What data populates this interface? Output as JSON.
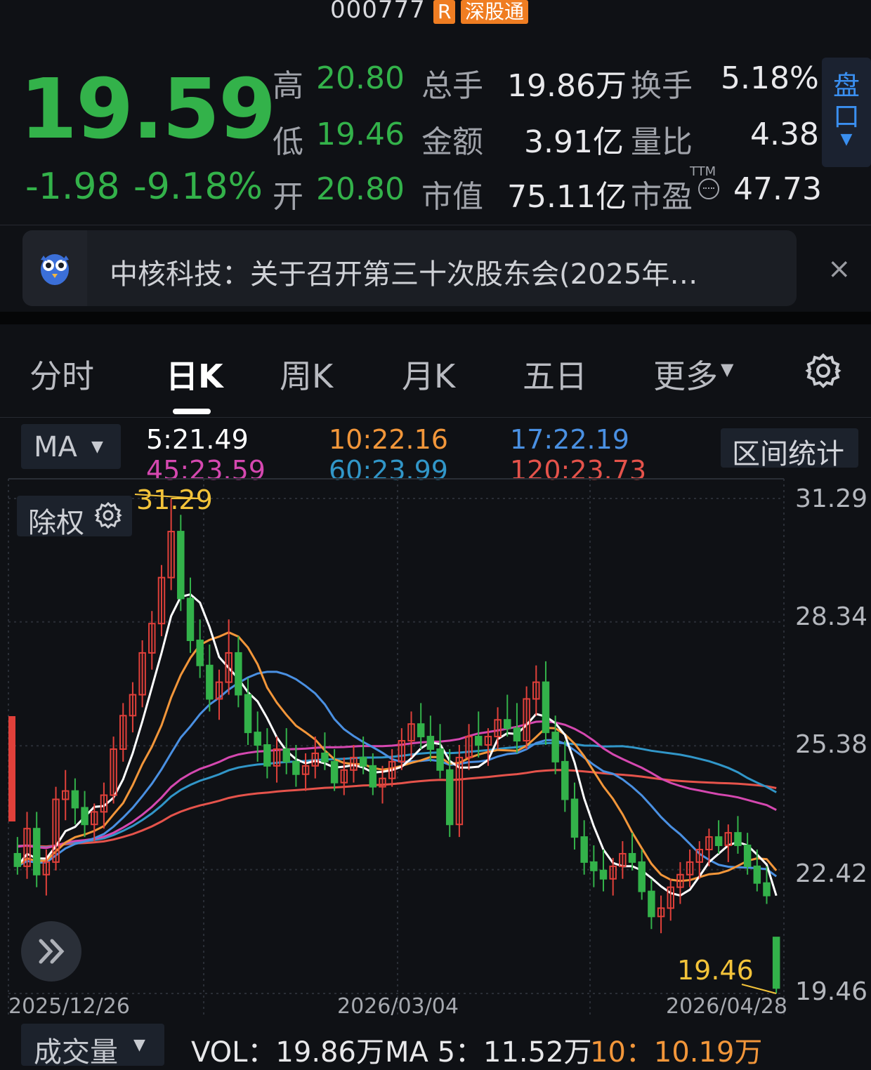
{
  "header": {
    "code": "000777",
    "badge_r": "R",
    "badge_connect": "深股通"
  },
  "quote": {
    "price": "19.59",
    "change": "-1.98",
    "change_pct": "-9.18%",
    "rows": [
      [
        {
          "k": "高",
          "v": "20.80"
        },
        {
          "k": "总手",
          "v": "19.86万"
        },
        {
          "k": "换手",
          "v": "5.18%"
        }
      ],
      [
        {
          "k": "低",
          "v": "19.46"
        },
        {
          "k": "金额",
          "v": "3.91亿"
        },
        {
          "k": "量比",
          "v": "4.38"
        }
      ],
      [
        {
          "k": "开",
          "v": "20.80"
        },
        {
          "k": "市值",
          "v": "75.11亿"
        },
        {
          "k": "市盈",
          "v": "47.73",
          "sup": "TTM"
        }
      ]
    ],
    "pankou": [
      "盘",
      "口"
    ]
  },
  "notice": {
    "text": "中核科技：关于召开第三十次股东会(2025年…",
    "close": "×"
  },
  "tabs": [
    "分时",
    "日K",
    "周K",
    "月K",
    "五日",
    "更多"
  ],
  "ma": {
    "selector": "MA",
    "values": [
      {
        "label": "5:21.49",
        "color": "#ffffff"
      },
      {
        "label": "10:22.16",
        "color": "#f2963a"
      },
      {
        "label": "17:22.19",
        "color": "#4a90e2"
      },
      {
        "label": "45:23.59",
        "color": "#d548b0"
      },
      {
        "label": "60:23.99",
        "color": "#3196c8"
      },
      {
        "label": "120:23.73",
        "color": "#e5534b"
      }
    ],
    "stat_button": "区间统计"
  },
  "chart_data": {
    "type": "candlestick",
    "chuquan": "除权",
    "y_ticks": [
      "31.29",
      "28.34",
      "25.38",
      "22.42",
      "19.46"
    ],
    "ylim": [
      19.46,
      31.29
    ],
    "x_ticks": [
      "2025/12/26",
      "2026/03/04",
      "2026/04/28"
    ],
    "high_mark": "31.29",
    "low_mark": "19.46",
    "colors": {
      "up": "#e0403a",
      "down": "#33b24a"
    },
    "candles": [
      [
        22.8,
        23.2,
        22.3,
        22.5
      ],
      [
        22.5,
        23.8,
        22.2,
        23.4
      ],
      [
        23.4,
        23.8,
        22.0,
        22.3
      ],
      [
        22.3,
        22.9,
        21.8,
        22.6
      ],
      [
        22.6,
        24.4,
        22.4,
        24.1
      ],
      [
        24.1,
        24.8,
        23.6,
        24.3
      ],
      [
        24.3,
        24.6,
        23.5,
        23.9
      ],
      [
        23.9,
        24.3,
        23.2,
        23.5
      ],
      [
        23.5,
        24.0,
        23.1,
        23.8
      ],
      [
        23.8,
        24.5,
        23.4,
        24.2
      ],
      [
        24.2,
        25.6,
        24.0,
        25.3
      ],
      [
        25.3,
        26.4,
        25.0,
        26.1
      ],
      [
        26.1,
        26.9,
        25.7,
        26.6
      ],
      [
        26.6,
        27.9,
        26.3,
        27.6
      ],
      [
        27.6,
        28.6,
        27.2,
        28.3
      ],
      [
        28.3,
        29.7,
        28.0,
        29.4
      ],
      [
        29.4,
        31.29,
        29.1,
        30.5
      ],
      [
        30.5,
        30.9,
        28.6,
        28.9
      ],
      [
        28.9,
        29.4,
        27.6,
        27.9
      ],
      [
        27.9,
        28.4,
        27.0,
        27.3
      ],
      [
        27.3,
        27.8,
        26.2,
        26.5
      ],
      [
        26.5,
        27.2,
        26.0,
        26.9
      ],
      [
        26.9,
        28.4,
        26.6,
        27.6
      ],
      [
        27.6,
        28.0,
        26.3,
        26.6
      ],
      [
        26.6,
        27.0,
        25.4,
        25.7
      ],
      [
        25.7,
        26.2,
        25.0,
        25.4
      ],
      [
        25.4,
        25.8,
        24.6,
        24.9
      ],
      [
        24.9,
        25.6,
        24.5,
        25.3
      ],
      [
        25.3,
        25.8,
        24.7,
        25.0
      ],
      [
        25.0,
        25.4,
        24.4,
        24.7
      ],
      [
        24.7,
        25.2,
        24.3,
        24.9
      ],
      [
        24.9,
        25.6,
        24.6,
        25.2
      ],
      [
        25.2,
        25.7,
        24.8,
        25.0
      ],
      [
        25.0,
        25.3,
        24.3,
        24.5
      ],
      [
        24.5,
        25.1,
        24.2,
        24.8
      ],
      [
        24.8,
        25.4,
        24.5,
        25.1
      ],
      [
        25.1,
        25.6,
        24.7,
        24.9
      ],
      [
        24.9,
        25.2,
        24.2,
        24.4
      ],
      [
        24.4,
        24.9,
        24.0,
        24.6
      ],
      [
        24.6,
        25.3,
        24.4,
        25.0
      ],
      [
        25.0,
        25.8,
        24.8,
        25.5
      ],
      [
        25.5,
        26.2,
        25.1,
        25.9
      ],
      [
        25.9,
        26.4,
        25.3,
        25.6
      ],
      [
        25.6,
        26.1,
        25.0,
        25.3
      ],
      [
        25.3,
        25.9,
        24.6,
        24.8
      ],
      [
        24.8,
        25.3,
        23.2,
        23.5
      ],
      [
        23.5,
        25.4,
        23.2,
        25.1
      ],
      [
        25.1,
        25.9,
        24.8,
        25.6
      ],
      [
        25.6,
        26.2,
        25.1,
        25.4
      ],
      [
        25.4,
        25.8,
        24.9,
        25.6
      ],
      [
        25.6,
        26.3,
        25.3,
        26.0
      ],
      [
        26.0,
        26.6,
        25.6,
        25.8
      ],
      [
        25.8,
        26.4,
        25.2,
        25.5
      ],
      [
        25.5,
        26.8,
        25.3,
        26.5
      ],
      [
        26.5,
        27.3,
        26.1,
        26.9
      ],
      [
        26.9,
        27.4,
        25.4,
        25.7
      ],
      [
        25.7,
        26.1,
        24.7,
        25.0
      ],
      [
        25.0,
        25.5,
        23.8,
        24.1
      ],
      [
        24.1,
        24.5,
        22.9,
        23.2
      ],
      [
        23.2,
        23.6,
        22.3,
        22.6
      ],
      [
        22.6,
        23.0,
        22.0,
        22.4
      ],
      [
        22.4,
        22.9,
        21.9,
        22.2
      ],
      [
        22.2,
        22.7,
        21.8,
        22.5
      ],
      [
        22.5,
        23.1,
        22.2,
        22.8
      ],
      [
        22.8,
        23.3,
        22.4,
        22.6
      ],
      [
        22.6,
        22.9,
        21.7,
        21.9
      ],
      [
        21.9,
        22.2,
        21.0,
        21.3
      ],
      [
        21.3,
        21.8,
        20.9,
        21.5
      ],
      [
        21.5,
        22.2,
        21.2,
        22.0
      ],
      [
        22.0,
        22.6,
        21.6,
        22.3
      ],
      [
        22.3,
        22.9,
        22.0,
        22.6
      ],
      [
        22.6,
        23.1,
        22.2,
        22.9
      ],
      [
        22.9,
        23.4,
        22.5,
        23.2
      ],
      [
        23.2,
        23.6,
        22.8,
        23.0
      ],
      [
        23.0,
        23.5,
        22.6,
        23.3
      ],
      [
        23.3,
        23.7,
        22.8,
        23.0
      ],
      [
        23.0,
        23.3,
        22.3,
        22.5
      ],
      [
        22.5,
        22.9,
        21.9,
        22.1
      ],
      [
        22.1,
        22.5,
        21.6,
        21.8
      ],
      [
        20.8,
        20.8,
        19.46,
        19.59
      ]
    ]
  },
  "volume": {
    "selector": "成交量",
    "items": [
      {
        "label": "VOL：19.86万",
        "color": "#e8e8ea"
      },
      {
        "label": "MA 5：11.52万",
        "color": "#e8e8ea"
      },
      {
        "label": "10：10.19万",
        "color": "#f2963a"
      }
    ]
  }
}
